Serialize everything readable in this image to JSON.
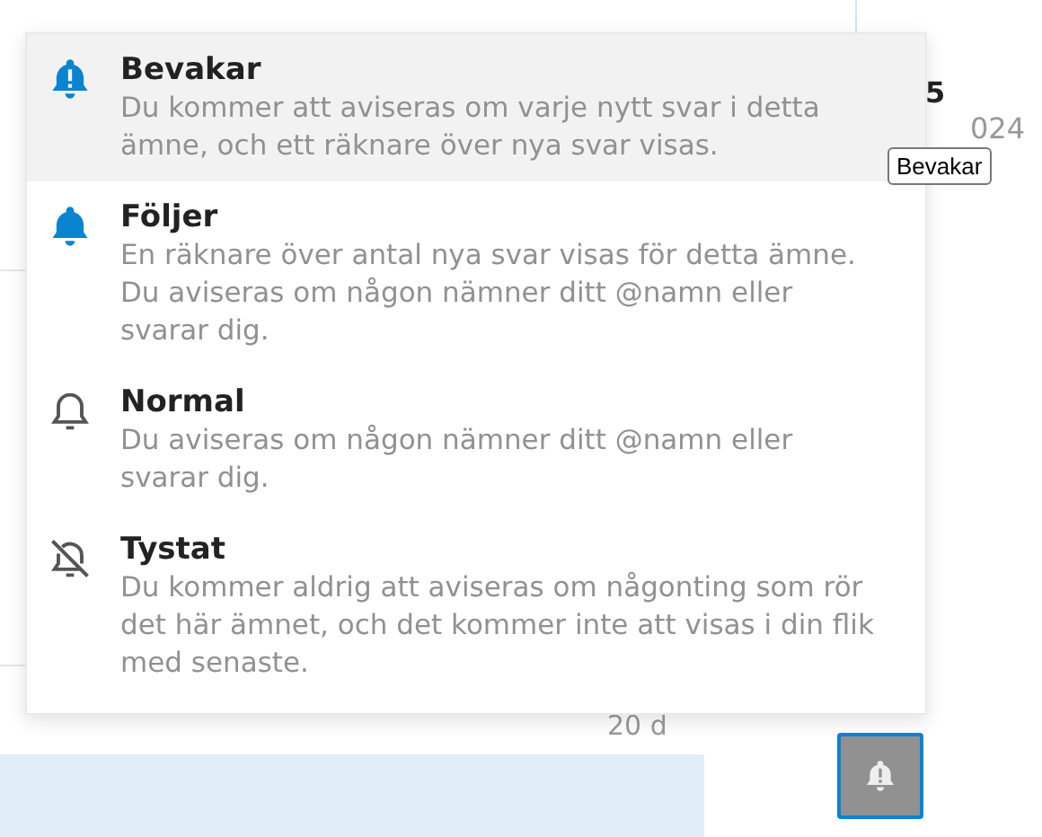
{
  "background": {
    "reply_count": "5",
    "year": "024",
    "age": "20 d"
  },
  "menu": {
    "items": [
      {
        "kind": "watching",
        "title": "Bevakar",
        "description": "Du kommer att aviseras om varje nytt svar i detta ämne, och ett räknare över nya svar visas.",
        "selected": true
      },
      {
        "kind": "tracking",
        "title": "Följer",
        "description": "En räknare över antal nya svar visas för detta ämne. Du aviseras om någon nämner ditt @namn eller svarar dig.",
        "selected": false
      },
      {
        "kind": "regular",
        "title": "Normal",
        "description": "Du aviseras om någon nämner ditt @namn eller svarar dig.",
        "selected": false
      },
      {
        "kind": "muted",
        "title": "Tystat",
        "description": "Du kommer aldrig att aviseras om någonting som rör det här ämnet, och det kommer inte att visas i din flik med senaste.",
        "selected": false
      }
    ]
  },
  "tooltip": "Bevakar",
  "notification_button": {
    "kind": "watching"
  }
}
